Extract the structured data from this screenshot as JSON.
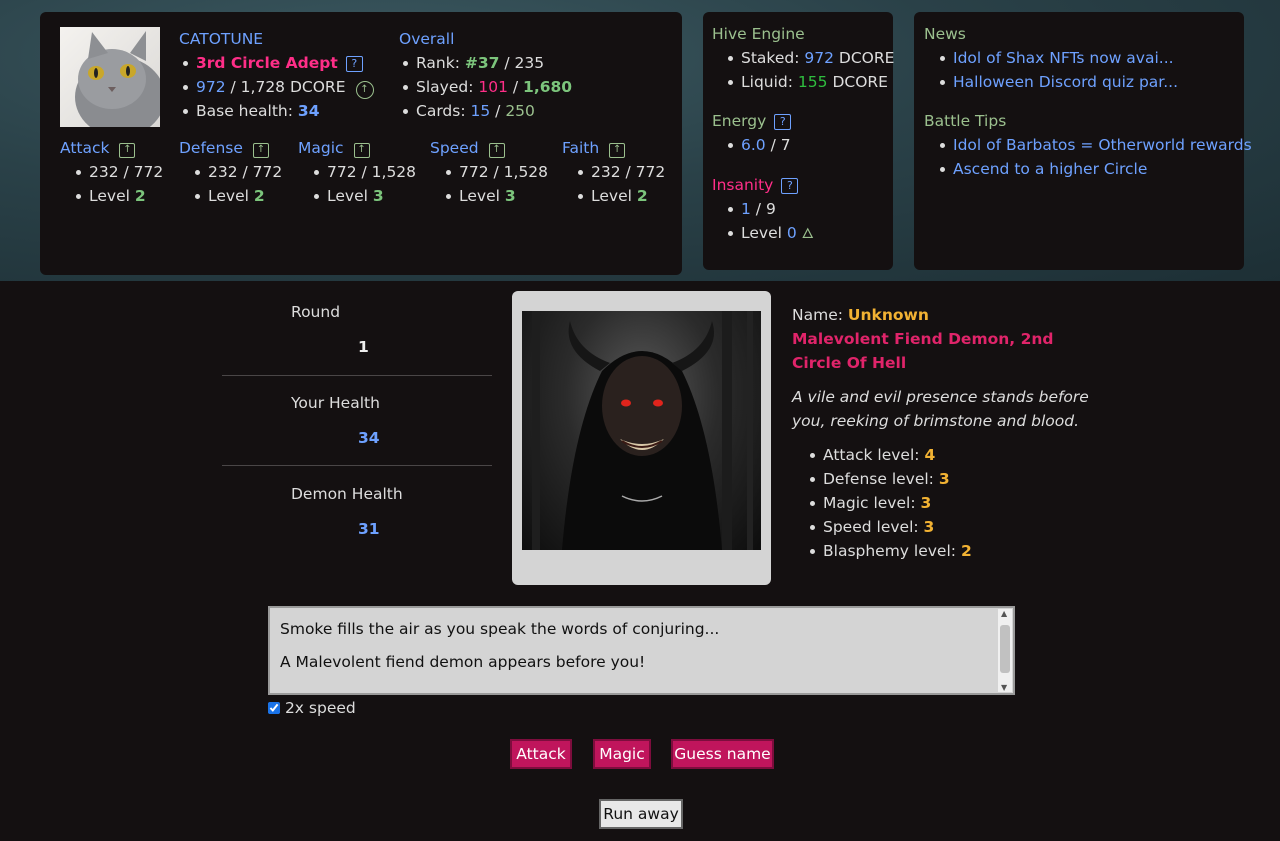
{
  "player": {
    "name": "CATOTUNE",
    "title": "3rd Circle Adept",
    "dcore_current": "972",
    "dcore_total": "1,728 DCORE",
    "base_health_label": "Base health:",
    "base_health": "34"
  },
  "overall": {
    "heading": "Overall",
    "rank_label": "Rank:",
    "rank": "#37",
    "rank_total": "235",
    "slayed_label": "Slayed:",
    "slayed": "101",
    "slayed_total": "1,680",
    "cards_label": "Cards:",
    "cards": "15",
    "cards_total": "250"
  },
  "stats": [
    {
      "name": "Attack",
      "value": "232 / 772",
      "level_label": "Level",
      "level": "2"
    },
    {
      "name": "Defense",
      "value": "232 / 772",
      "level_label": "Level",
      "level": "2"
    },
    {
      "name": "Magic",
      "value": "772 / 1,528",
      "level_label": "Level",
      "level": "3"
    },
    {
      "name": "Speed",
      "value": "772 / 1,528",
      "level_label": "Level",
      "level": "3"
    },
    {
      "name": "Faith",
      "value": "232 / 772",
      "level_label": "Level",
      "level": "2"
    }
  ],
  "hive": {
    "heading": "Hive Engine",
    "staked_label": "Staked:",
    "staked": "972",
    "liquid_label": "Liquid:",
    "liquid": "155",
    "unit": "DCORE"
  },
  "energy": {
    "heading": "Energy",
    "value": "6.0",
    "max": "7"
  },
  "insanity": {
    "heading": "Insanity",
    "value": "1",
    "max": "9",
    "level_label": "Level",
    "level": "0"
  },
  "news": {
    "heading": "News",
    "items": [
      "Idol of Shax NFTs now avai...",
      "Halloween Discord quiz par..."
    ]
  },
  "tips": {
    "heading": "Battle Tips",
    "items": [
      "Idol of Barbatos = Otherworld rewards",
      "Ascend to a higher Circle"
    ]
  },
  "battle": {
    "round_label": "Round",
    "round": "1",
    "your_health_label": "Your Health",
    "your_health": "34",
    "demon_health_label": "Demon Health",
    "demon_health": "31"
  },
  "demon": {
    "name_label": "Name:",
    "name": "Unknown",
    "type_line1": "Malevolent Fiend Demon, 2nd",
    "type_line2": "Circle Of Hell",
    "desc_line1": "A vile and evil presence stands before",
    "desc_line2": "you, reeking of brimstone and blood.",
    "levels": [
      {
        "label": "Attack level:",
        "value": "4"
      },
      {
        "label": "Defense level:",
        "value": "3"
      },
      {
        "label": "Magic level:",
        "value": "3"
      },
      {
        "label": "Speed level:",
        "value": "3"
      },
      {
        "label": "Blasphemy level:",
        "value": "2"
      }
    ]
  },
  "log": [
    "Smoke fills the air as you speak the words of conjuring...",
    "A Malevolent fiend demon appears before you!"
  ],
  "speed_option": {
    "label": "2x speed",
    "checked": true
  },
  "actions": {
    "attack": "Attack",
    "magic": "Magic",
    "guess": "Guess name",
    "run": "Run away"
  },
  "colors": {
    "accent_blue": "#6ea1ff",
    "accent_pink": "#ff2e88",
    "button": "#c0155c",
    "gold": "#f2b233",
    "green": "#7cc57c"
  }
}
